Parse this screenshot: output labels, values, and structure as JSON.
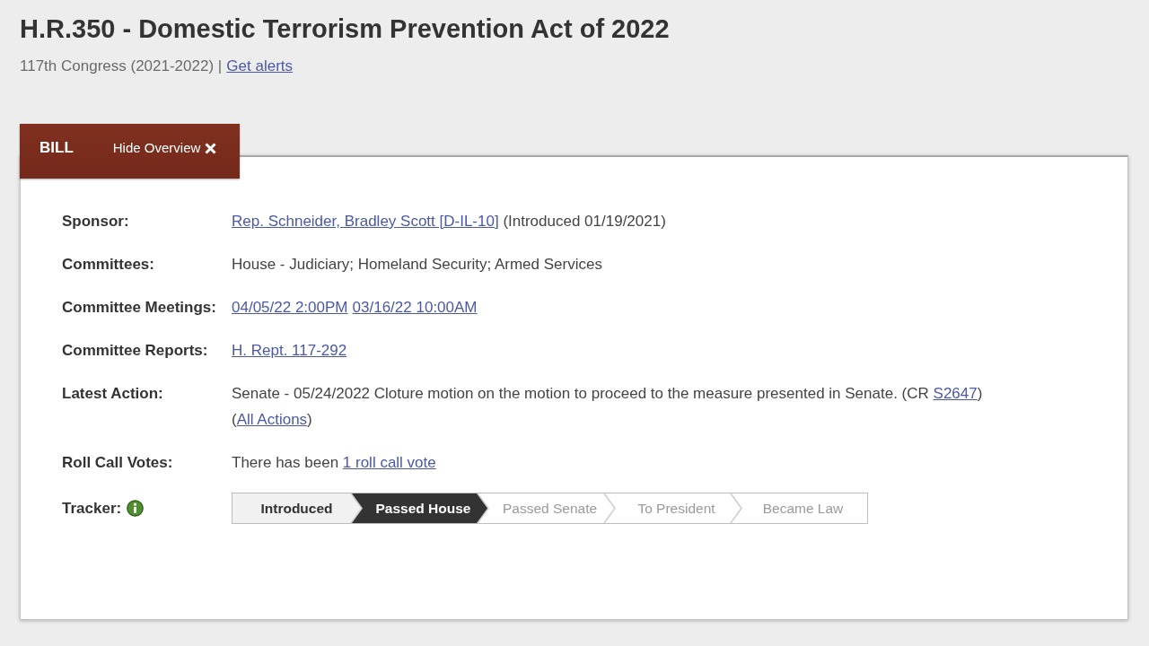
{
  "bill": {
    "title": "H.R.350 - Domestic Terrorism Prevention Act of 2022",
    "congress": "117th Congress (2021-2022) |",
    "alerts_link": "Get alerts"
  },
  "overview": {
    "tab_label": "BILL",
    "toggle_label": "Hide Overview",
    "rows": [
      {
        "label": "Sponsor:",
        "value": [
          {
            "kind": "link",
            "text": "Rep. Schneider, Bradley Scott [D-IL-10]"
          },
          {
            "kind": "text",
            "text": " (Introduced 01/19/2021)"
          }
        ]
      },
      {
        "label": "Committees:",
        "value": [
          {
            "kind": "text",
            "text": "House - Judiciary; Homeland Security; Armed Services"
          }
        ]
      },
      {
        "label": "Committee Meetings:",
        "value": [
          {
            "kind": "link",
            "text": "04/05/22 2:00PM"
          },
          {
            "kind": "link",
            "text": "03/16/22 10:00AM"
          }
        ]
      },
      {
        "label": "Committee Reports:",
        "value": [
          {
            "kind": "link",
            "text": "H. Rept. 117-292"
          }
        ]
      },
      {
        "label": "Latest Action:",
        "value": [
          {
            "kind": "text",
            "text": "Senate - 05/24/2022 Cloture motion on the motion to proceed to the measure presented in Senate. (CR "
          },
          {
            "kind": "link",
            "text": "S2647"
          },
          {
            "kind": "text",
            "text": ")  ("
          },
          {
            "kind": "link",
            "text": "All Actions"
          },
          {
            "kind": "text",
            "text": ")"
          }
        ]
      },
      {
        "label": "Roll Call Votes:",
        "value": [
          {
            "kind": "text",
            "text": "There has been "
          },
          {
            "kind": "link",
            "text": "1 roll call vote"
          }
        ]
      }
    ],
    "tracker": {
      "label": "Tracker:",
      "steps": [
        {
          "label": "Introduced",
          "completed": true,
          "current": false
        },
        {
          "label": "Passed House",
          "completed": true,
          "current": true
        },
        {
          "label": "Passed Senate",
          "completed": false,
          "current": false
        },
        {
          "label": "To President",
          "completed": false,
          "current": false
        },
        {
          "label": "Became Law",
          "completed": false,
          "current": false
        }
      ]
    }
  }
}
